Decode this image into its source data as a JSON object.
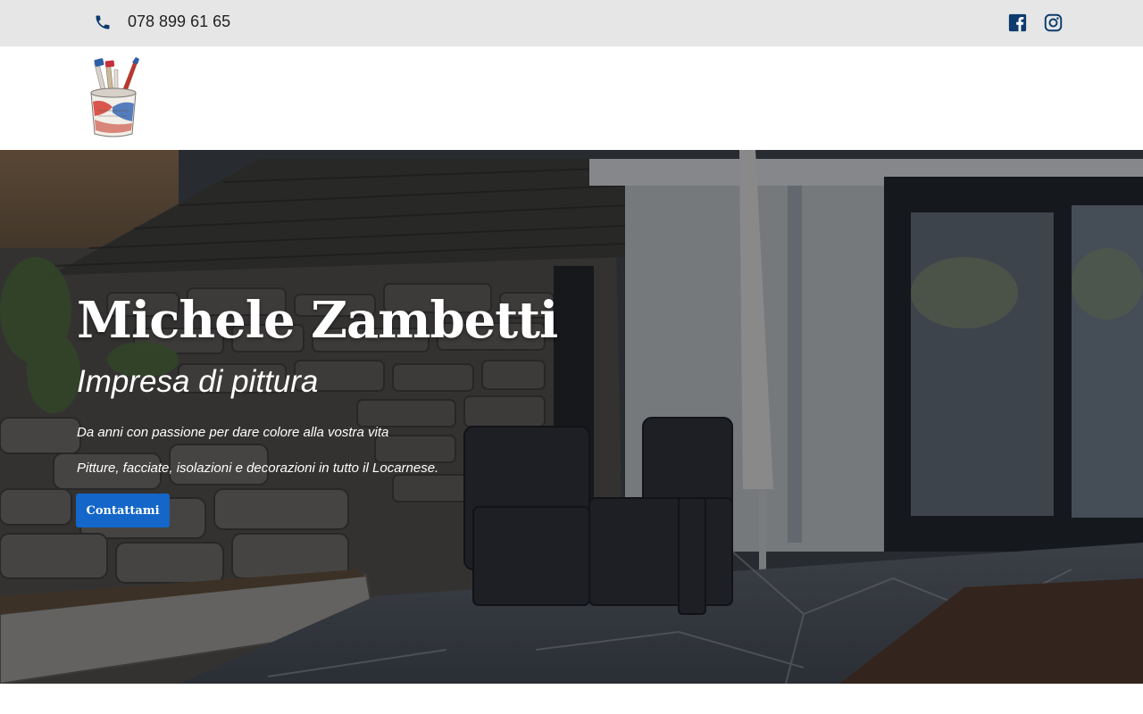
{
  "topbar": {
    "phone": "078 899 61 65",
    "icons": {
      "phone": "phone-icon",
      "facebook": "facebook-icon",
      "instagram": "instagram-icon"
    },
    "icon_color": "#0d3b6e"
  },
  "header": {
    "logo": "paint-bucket-logo"
  },
  "hero": {
    "title": "Michele Zambetti",
    "subtitle": "Impresa di pittura",
    "line1": "Da anni con passione per dare colore alla vostra vita",
    "line2": "Pitture, facciate, isolazioni e decorazioni in tutto il Locarnese.",
    "cta_label": "Contattami",
    "cta_color": "#1466c8"
  }
}
